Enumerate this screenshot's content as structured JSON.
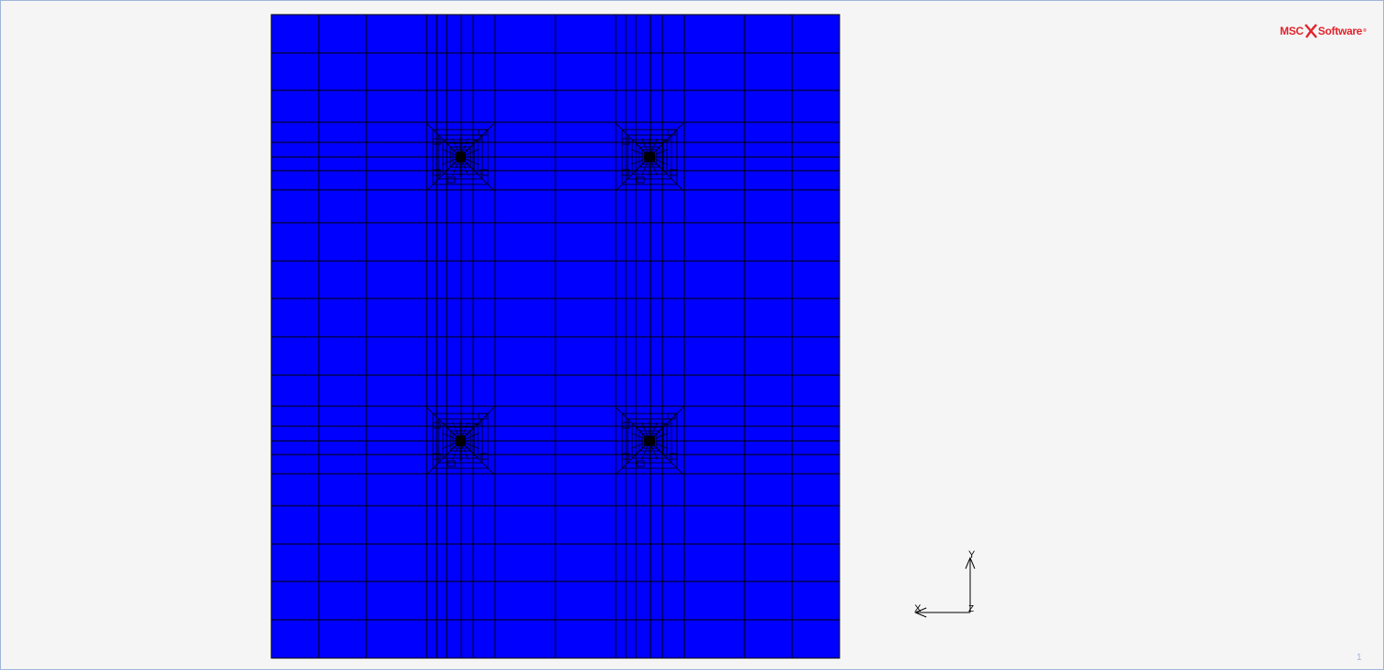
{
  "viewport": {
    "model_color": "#0000ff",
    "edge_color": "#000000",
    "background_color": "#f5f5f5",
    "border_color": "#9fb4d8"
  },
  "logo": {
    "brand_left": "MSC",
    "brand_right": "Software",
    "registered_mark": "®",
    "brand_color": "#e0242c"
  },
  "axis_triad": {
    "y_label": "Y",
    "x_label": "X",
    "z_label": "Z"
  },
  "page_number": "1"
}
